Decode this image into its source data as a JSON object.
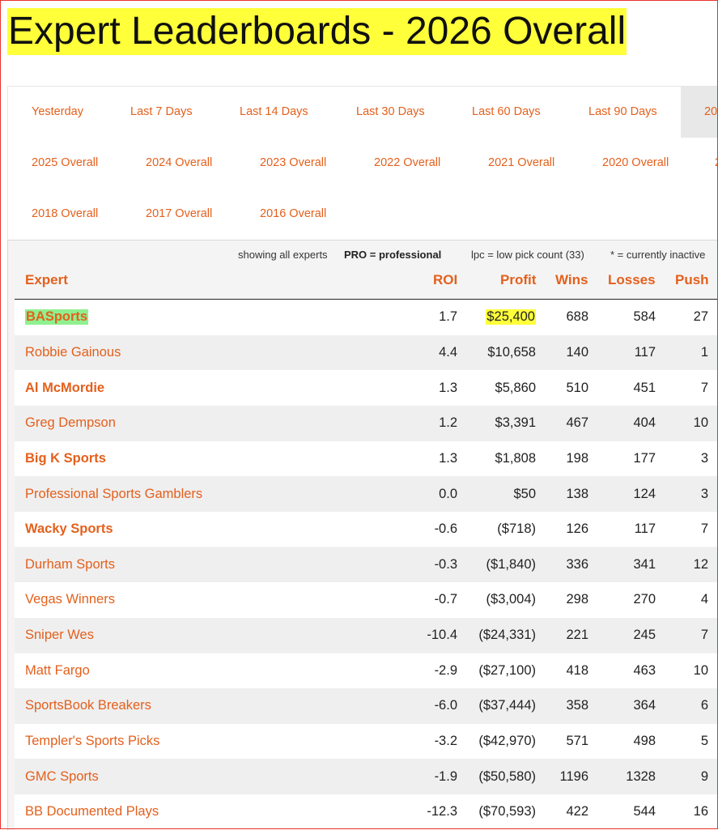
{
  "page_title": "Expert Leaderboards - 2026 Overall",
  "tabs": {
    "row1": [
      "Yesterday",
      "Last 7 Days",
      "Last 14 Days",
      "Last 30 Days",
      "Last 60 Days",
      "Last 90 Days",
      "20"
    ],
    "row2": [
      "2025 Overall",
      "2024 Overall",
      "2023 Overall",
      "2022 Overall",
      "2021 Overall",
      "2020 Overall",
      "2"
    ],
    "row3": [
      "2018 Overall",
      "2017 Overall",
      "2016 Overall"
    ]
  },
  "legend": {
    "showing": "showing all experts",
    "pro": "PRO = professional",
    "lpc": "lpc = low pick count (33)",
    "inactive": "* = currently inactive"
  },
  "table": {
    "headers": {
      "expert": "Expert",
      "roi": "ROI",
      "profit": "Profit",
      "wins": "Wins",
      "losses": "Losses",
      "push": "Push"
    },
    "rows": [
      {
        "expert": "BASports",
        "roi": "1.7",
        "profit": "$25,400",
        "wins": "688",
        "losses": "584",
        "push": "27"
      },
      {
        "expert": "Robbie Gainous",
        "roi": "4.4",
        "profit": "$10,658",
        "wins": "140",
        "losses": "117",
        "push": "1"
      },
      {
        "expert": "Al McMordie",
        "roi": "1.3",
        "profit": "$5,860",
        "wins": "510",
        "losses": "451",
        "push": "7"
      },
      {
        "expert": "Greg Dempson",
        "roi": "1.2",
        "profit": "$3,391",
        "wins": "467",
        "losses": "404",
        "push": "10"
      },
      {
        "expert": "Big K Sports",
        "roi": "1.3",
        "profit": "$1,808",
        "wins": "198",
        "losses": "177",
        "push": "3"
      },
      {
        "expert": "Professional Sports Gamblers",
        "roi": "0.0",
        "profit": "$50",
        "wins": "138",
        "losses": "124",
        "push": "3"
      },
      {
        "expert": "Wacky Sports",
        "roi": "-0.6",
        "profit": "($718)",
        "wins": "126",
        "losses": "117",
        "push": "7"
      },
      {
        "expert": "Durham Sports",
        "roi": "-0.3",
        "profit": "($1,840)",
        "wins": "336",
        "losses": "341",
        "push": "12"
      },
      {
        "expert": "Vegas Winners",
        "roi": "-0.7",
        "profit": "($3,004)",
        "wins": "298",
        "losses": "270",
        "push": "4"
      },
      {
        "expert": "Sniper Wes",
        "roi": "-10.4",
        "profit": "($24,331)",
        "wins": "221",
        "losses": "245",
        "push": "7"
      },
      {
        "expert": "Matt Fargo",
        "roi": "-2.9",
        "profit": "($27,100)",
        "wins": "418",
        "losses": "463",
        "push": "10"
      },
      {
        "expert": "SportsBook Breakers",
        "roi": "-6.0",
        "profit": "($37,444)",
        "wins": "358",
        "losses": "364",
        "push": "6"
      },
      {
        "expert": "Templer's Sports Picks",
        "roi": "-3.2",
        "profit": "($42,970)",
        "wins": "571",
        "losses": "498",
        "push": "5"
      },
      {
        "expert": "GMC Sports",
        "roi": "-1.9",
        "profit": "($50,580)",
        "wins": "1196",
        "losses": "1328",
        "push": "9"
      },
      {
        "expert": "BB Documented Plays",
        "roi": "-12.3",
        "profit": "($70,593)",
        "wins": "422",
        "losses": "544",
        "push": "16"
      }
    ]
  },
  "colors": {
    "accent": "#e4601c",
    "title_highlight": "#ffff3a",
    "name_highlight": "#8ff08f",
    "frame": "#e8332e"
  }
}
